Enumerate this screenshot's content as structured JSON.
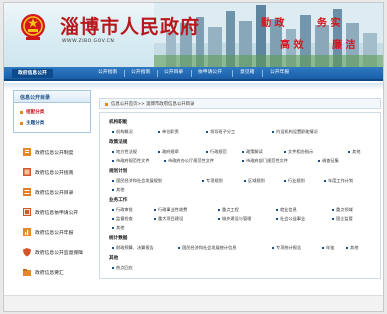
{
  "header": {
    "title": "淄博市人民政府",
    "url": "WWW.ZIBO.GOV.CN",
    "slogan": [
      "勤 政",
      "务 实",
      "高 效",
      "廉 洁"
    ]
  },
  "nav": {
    "brand": "政府信息公开",
    "items": [
      "公开指南",
      "公开指南",
      "公开目录",
      "依申请公开",
      "意见箱",
      "公开年报"
    ]
  },
  "sidebar": {
    "title": "信息公开目录",
    "subs": [
      "组配分类",
      "主题分类"
    ],
    "items": [
      "政府信息公开制度",
      "政府信息公开指南",
      "政府信息公开目录",
      "政府信息依申请公开",
      "政府信息公开年报",
      "政府信息公开监督保障",
      "政府信息要汇"
    ]
  },
  "breadcrumb": "信息公开首页>> 淄博市政府信息公开目录",
  "catalog": [
    {
      "title": "机构职能",
      "rows": [
        [
          "机构概况",
          "单位职责",
          "领导班子分工",
          "内设机构设置职能情况"
        ]
      ]
    },
    {
      "title": "政策法规",
      "rows": [
        [
          "地方性法规",
          "政府规章",
          "行政规范",
          "政策解读",
          "文件相办指示",
          "其他"
        ],
        [
          "市政府规范性文件",
          "市政府办公厅规范性文件",
          "市政府部门规范性文件",
          "调查征集"
        ]
      ]
    },
    {
      "title": "规划计划",
      "rows": [
        [
          "国民经济和社会发展规划",
          "专项规划",
          "区域规划",
          "行业规划",
          "年度工作计划"
        ],
        [
          "其他"
        ]
      ]
    },
    {
      "title": "业务工作",
      "rows": [
        [
          "行政审批",
          "行政事业性收费",
          "重点工程",
          "就业信息",
          "重点领域"
        ],
        [
          "监督检查",
          "重大项目建设",
          "城乡建设与管理",
          "社会公益事业",
          "国企监管"
        ],
        [
          "其他"
        ]
      ]
    },
    {
      "title": "统计数据",
      "rows": [
        [
          "财政预算、决算报告",
          "国民经济和社会发展统计信息",
          "专项统计报告",
          "年鉴",
          "其他"
        ]
      ]
    },
    {
      "title": "其他",
      "rows": [
        [
          "热点回应"
        ]
      ]
    }
  ],
  "colors": {
    "brand_red": "#b8171b",
    "nav_blue": "#1a5ea8",
    "slogan_red": "#d4161d"
  }
}
